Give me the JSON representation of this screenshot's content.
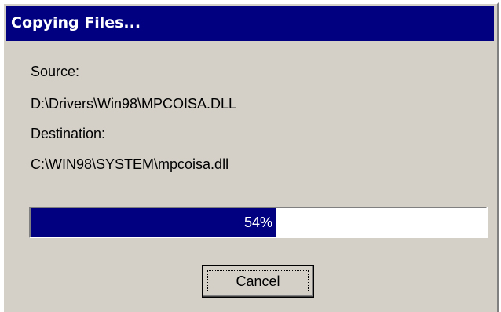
{
  "window": {
    "title": "Copying Files..."
  },
  "source": {
    "label": "Source:",
    "path": "D:\\Drivers\\Win98\\MPCOISA.DLL"
  },
  "destination": {
    "label": "Destination:",
    "path": "C:\\WIN98\\SYSTEM\\mpcoisa.dll"
  },
  "progress": {
    "percent": 54,
    "label": "54%",
    "fill_color": "#000080"
  },
  "buttons": {
    "cancel_label": "Cancel"
  },
  "colors": {
    "titlebar": "#000080",
    "face": "#d4d0c8"
  }
}
